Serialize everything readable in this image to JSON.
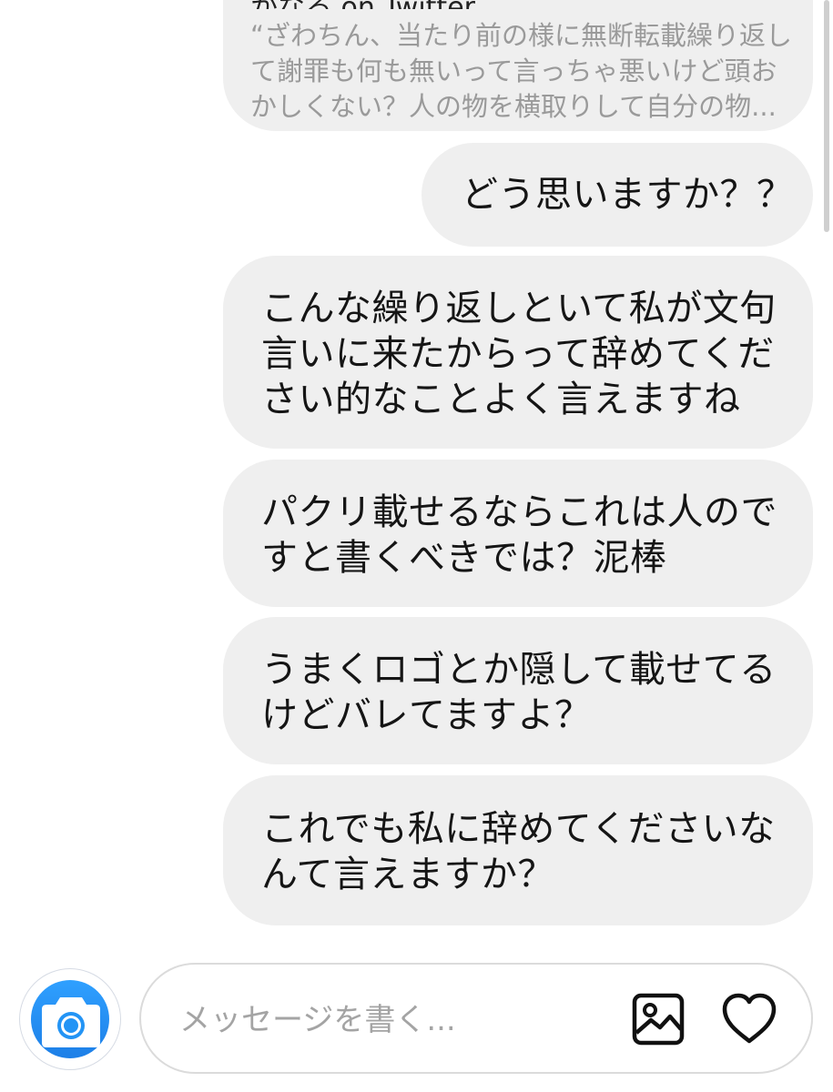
{
  "preview": {
    "sender": "かなる on Twitter",
    "quote": "“ざわちん、当たり前の様に無断転載繰り返し\nて謝罪も何も無いって言っちゃ悪いけど頭お\nかしくない？人の物を横取りして自分の物..."
  },
  "messages": [
    {
      "text": "どう思いますか？？"
    },
    {
      "text": "こんな繰り返しといて私が文句\n言いに来たからって辞めてくだ\nさい的なことよく言えますね"
    },
    {
      "text": "パクリ載せるならこれは人ので\nすと書くべきでは？泥棒"
    },
    {
      "text": "うまくロゴとか隠して載せてる\nけどバレてますよ？"
    },
    {
      "text": "これでも私に辞めてくださいな\nんて言えますか？"
    }
  ],
  "composer": {
    "placeholder": "メッセージを書く...",
    "value": ""
  },
  "icons": {
    "camera": "camera-icon",
    "gallery": "image-gallery-icon",
    "like": "heart-icon"
  },
  "colors": {
    "bubble": "#efefef",
    "camera_blue": "#2394f5",
    "quote_text": "#9a9a9a"
  }
}
